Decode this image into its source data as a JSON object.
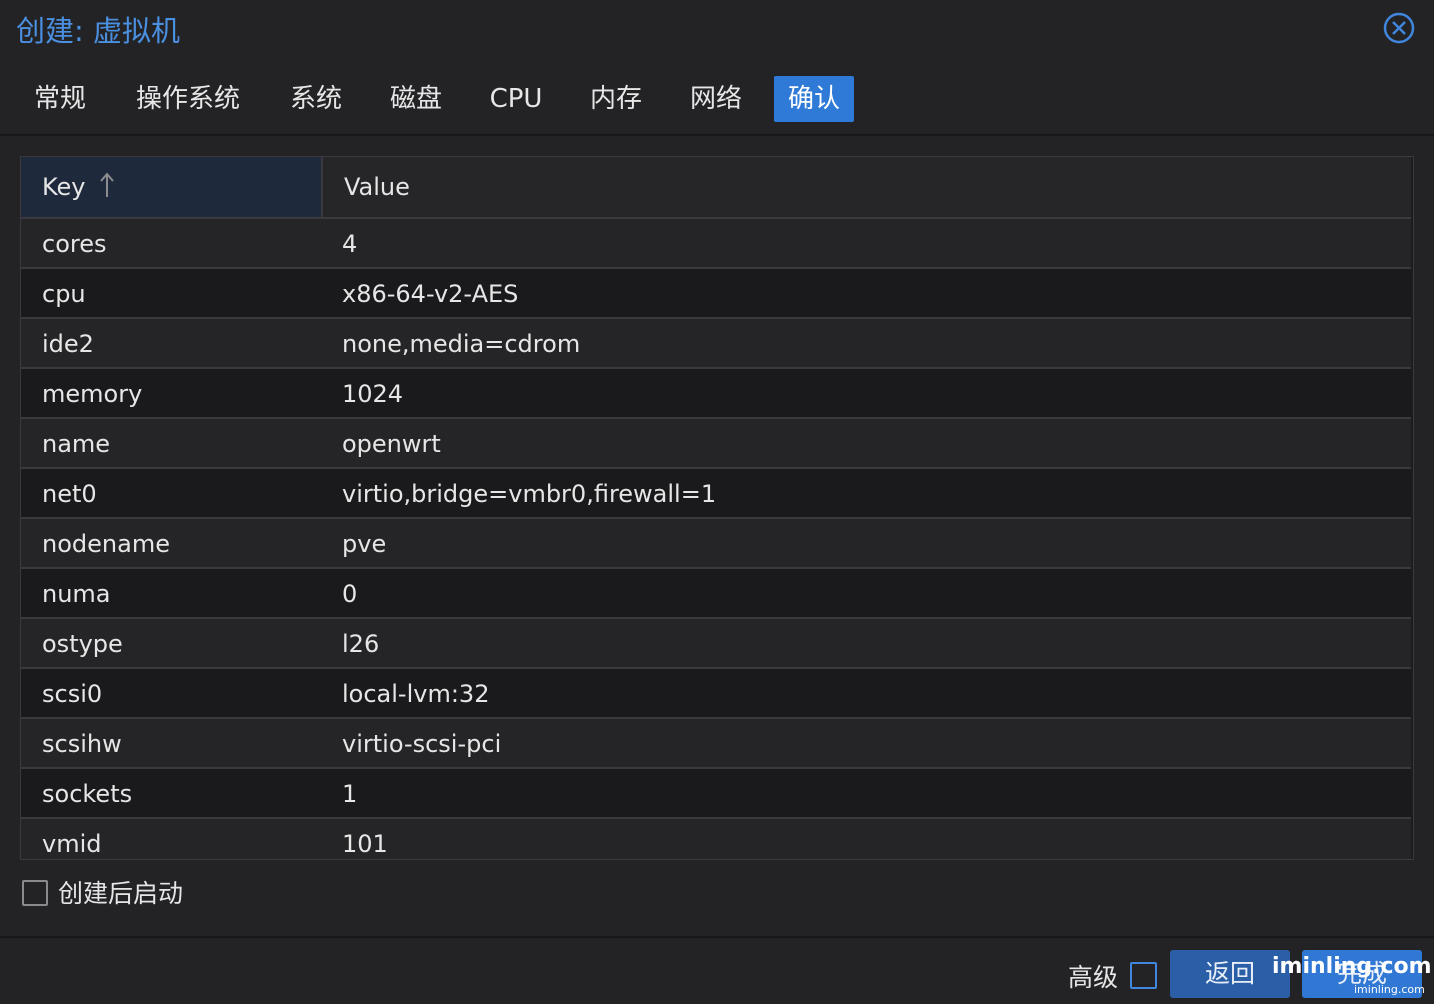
{
  "dialog": {
    "title": "创建: 虚拟机"
  },
  "tabs": [
    {
      "label": "常规",
      "id": "general"
    },
    {
      "label": "操作系统",
      "id": "os"
    },
    {
      "label": "系统",
      "id": "system"
    },
    {
      "label": "磁盘",
      "id": "disks"
    },
    {
      "label": "CPU",
      "id": "cpu"
    },
    {
      "label": "内存",
      "id": "memory"
    },
    {
      "label": "网络",
      "id": "network"
    },
    {
      "label": "确认",
      "id": "confirm",
      "active": true
    }
  ],
  "grid": {
    "columns": {
      "key": "Key",
      "value": "Value"
    },
    "sort": {
      "column": "key",
      "direction": "ascending"
    },
    "rows": [
      {
        "key": "cores",
        "value": "4"
      },
      {
        "key": "cpu",
        "value": "x86-64-v2-AES"
      },
      {
        "key": "ide2",
        "value": "none,media=cdrom"
      },
      {
        "key": "memory",
        "value": "1024"
      },
      {
        "key": "name",
        "value": "openwrt"
      },
      {
        "key": "net0",
        "value": "virtio,bridge=vmbr0,firewall=1"
      },
      {
        "key": "nodename",
        "value": "pve"
      },
      {
        "key": "numa",
        "value": "0"
      },
      {
        "key": "ostype",
        "value": "l26"
      },
      {
        "key": "scsi0",
        "value": "local-lvm:32"
      },
      {
        "key": "scsihw",
        "value": "virtio-scsi-pci"
      },
      {
        "key": "sockets",
        "value": "1"
      },
      {
        "key": "vmid",
        "value": "101"
      }
    ]
  },
  "start_after_create": {
    "label": "创建后启动",
    "checked": false
  },
  "footer": {
    "advanced_label": "高级",
    "advanced_checked": false,
    "back_label": "返回",
    "finish_label": "完成"
  },
  "watermark": {
    "text": "iminling.com",
    "small_text": "iminling.com"
  },
  "colors": {
    "accent": "#2f7ad6",
    "title": "#4a8fe0",
    "background": "#232326"
  }
}
